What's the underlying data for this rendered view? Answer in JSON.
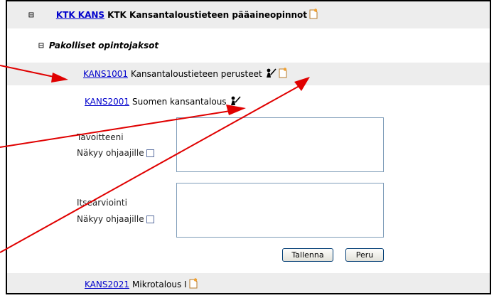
{
  "tree": {
    "program": {
      "code": "KTK KANS",
      "name": "KTK Kansantaloustieteen pääaineopinnot",
      "toggle": "⊟"
    },
    "group": {
      "name": "Pakolliset opintojaksot",
      "toggle": "⊟"
    },
    "courses": [
      {
        "code": "KANS1001",
        "name": "Kansantaloustieteen perusteet"
      },
      {
        "code": "KANS2001",
        "name": "Suomen kansantalous"
      },
      {
        "code": "KANS2021",
        "name": "Mikrotalous I"
      }
    ]
  },
  "form": {
    "goals_label": "Tavoitteeni",
    "goals_visible_label": "Näkyy ohjaajille",
    "self_eval_label": "Itsearviointi",
    "self_eval_visible_label": "Näkyy ohjaajille",
    "save_label": "Tallenna",
    "cancel_label": "Peru"
  },
  "colors": {
    "link": "#0000cc",
    "row_gray": "#ededed",
    "annotation_arrow": "#e00000"
  }
}
